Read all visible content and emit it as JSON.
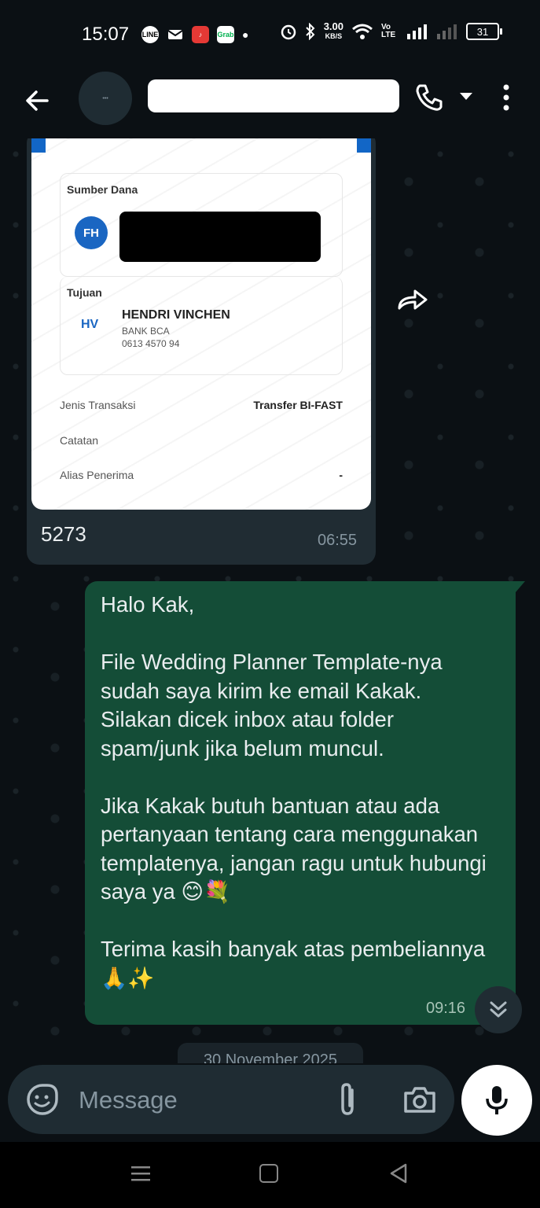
{
  "status_bar": {
    "time": "15:07",
    "net_speed_top": "3.00",
    "net_speed_bottom": "KB/S",
    "volte": "Vo LTE",
    "battery": "31"
  },
  "chat_header": {
    "avatar_text": "•••",
    "contact_name": ""
  },
  "incoming_message": {
    "receipt": {
      "sumber_dana_label": "Sumber Dana",
      "sender_initials": "FH",
      "tujuan_label": "Tujuan",
      "receiver_initials": "HV",
      "receiver_name": "HENDRI VINCHEN",
      "receiver_bank": "BANK BCA",
      "receiver_account": "0613 4570 94",
      "jenis_label": "Jenis Transaksi",
      "jenis_value": "Transfer BI-FAST",
      "catatan_label": "Catatan",
      "alias_label": "Alias Penerima",
      "alias_value": "-"
    },
    "caption": "5273",
    "time": "06:55"
  },
  "outgoing_message": {
    "text": "Halo Kak,\n\nFile Wedding Planner Template-nya sudah saya kirim ke email Kakak. Silakan dicek inbox atau folder spam/junk jika belum muncul.\n\nJika Kakak butuh bantuan atau ada pertanyaan tentang cara menggunakan templatenya, jangan ragu untuk hubungi saya ya 😊💐\n\nTerima kasih banyak atas pembeliannya 🙏✨",
    "time": "09:16"
  },
  "date_divider": "30 November 2025",
  "composer": {
    "placeholder": "Message"
  },
  "colors": {
    "outgoing_bubble": "#144d37",
    "incoming_bubble": "#202c33",
    "background": "#0b1014",
    "bri_blue": "#1266c6"
  }
}
